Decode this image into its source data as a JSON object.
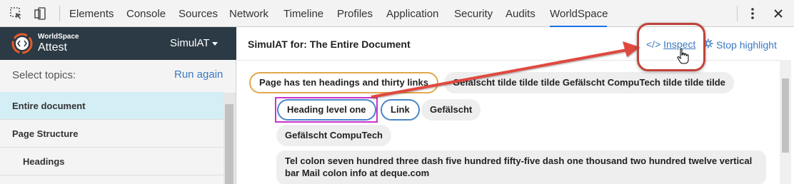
{
  "devtools": {
    "tabs": [
      {
        "label": "Elements"
      },
      {
        "label": "Console"
      },
      {
        "label": "Sources"
      },
      {
        "label": "Network"
      },
      {
        "label": "Timeline"
      },
      {
        "label": "Profiles"
      },
      {
        "label": "Application"
      },
      {
        "label": "Security"
      },
      {
        "label": "Audits"
      },
      {
        "label": "WorldSpace",
        "active": true
      }
    ],
    "icons": [
      "inspect-element-icon",
      "device-mode-icon",
      "more-vert-icon",
      "close-icon"
    ],
    "accent": "#1a73e8"
  },
  "sidebar": {
    "logo_top": "WorldSpace",
    "logo_bottom": "Attest",
    "select_value": "SimulAT",
    "topics_label": "Select topics:",
    "run_again": "Run again",
    "items": [
      {
        "label": "Entire document",
        "selected": true
      },
      {
        "label": "Page Structure"
      },
      {
        "label": "Headings"
      }
    ],
    "header_color": "#2b3a44",
    "selected_color": "#d4eef5"
  },
  "main": {
    "title": "SimulAT for: The Entire Document",
    "inspect_label": "Inspect",
    "inspect_icon": "code-icon",
    "stop_highlight_label": "Stop highlight",
    "stop_highlight_icon": "gear-icon",
    "pills": [
      {
        "label": "Page has ten headings and thirty links"
      },
      {
        "label": "Gefälscht tilde tilde tilde Gefälscht CompuTech tilde tilde tilde"
      },
      {
        "label": "Heading level one"
      },
      {
        "label": "Link"
      },
      {
        "label": "Gefälscht"
      },
      {
        "label": "Gefälscht CompuTech"
      },
      {
        "label": "Tel colon seven hundred three dash five hundred fifty-five dash one thousand two hundred twelve vertical bar Mail colon info at deque.com"
      }
    ],
    "annotation_color": "#c0433a",
    "focus_color": "#cc33cc"
  }
}
